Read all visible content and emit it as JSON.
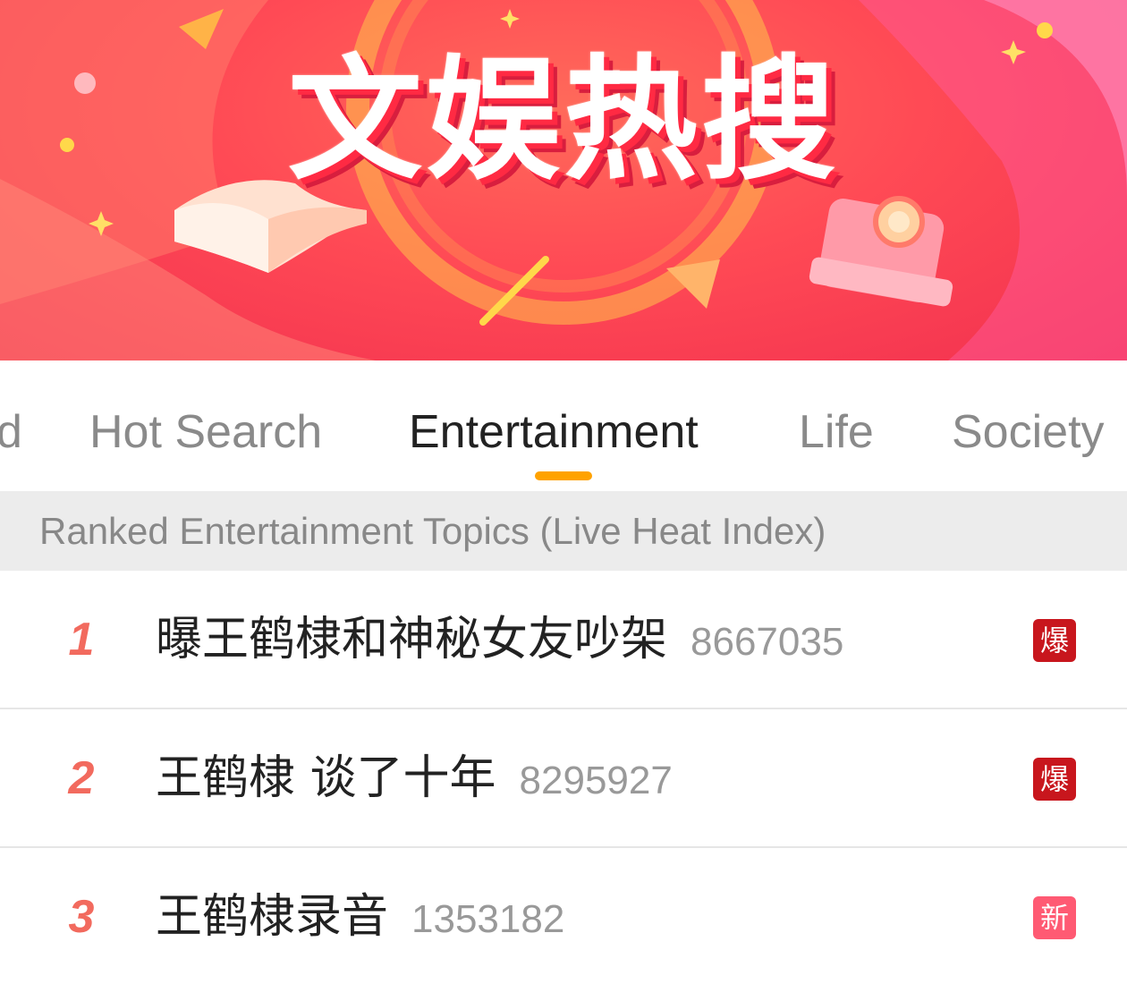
{
  "banner": {
    "title": "文娱热搜",
    "colors": {
      "background": "#f2304f",
      "accent": "#ffd84a"
    }
  },
  "tabs": [
    {
      "label": "d",
      "active": false
    },
    {
      "label": "Hot Search",
      "active": false
    },
    {
      "label": "Entertainment",
      "active": true
    },
    {
      "label": "Life",
      "active": false
    },
    {
      "label": "Society",
      "active": false
    }
  ],
  "section": {
    "header": "Ranked Entertainment Topics (Live Heat Index)"
  },
  "list": [
    {
      "rank": "1",
      "topic": "曝王鹤棣和神秘女友吵架",
      "heat": "8667035",
      "badge": "爆",
      "badge_color": "#c8161d"
    },
    {
      "rank": "2",
      "topic": "王鹤棣 谈了十年",
      "heat": "8295927",
      "badge": "爆",
      "badge_color": "#c8161d"
    },
    {
      "rank": "3",
      "topic": "王鹤棣录音",
      "heat": "1353182",
      "badge": "新",
      "badge_color": "#ff5a73"
    }
  ],
  "icons": [
    "sparkle-icon",
    "book-icon",
    "camera-icon"
  ]
}
